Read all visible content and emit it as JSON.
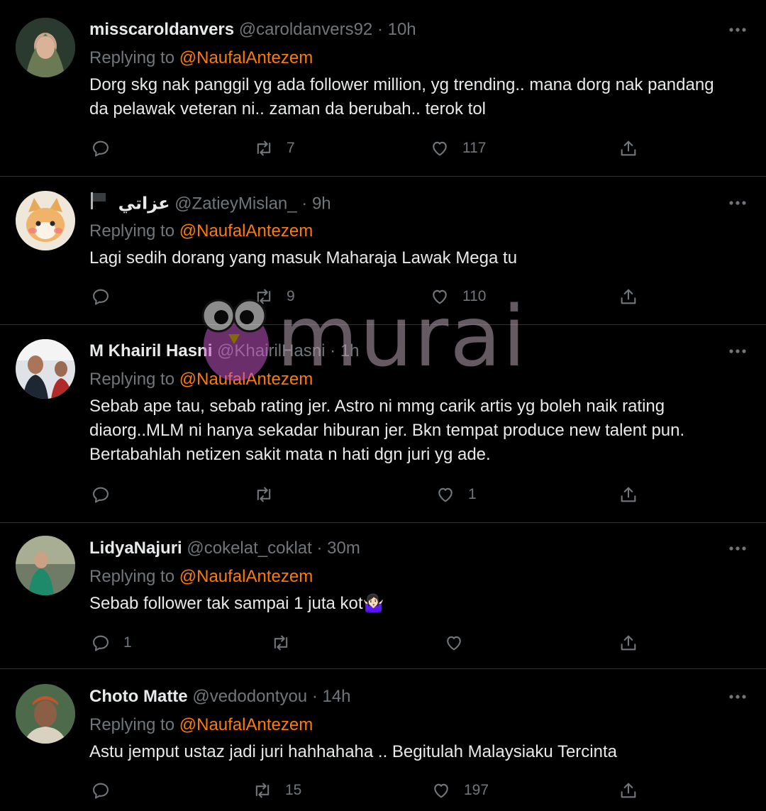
{
  "colors": {
    "background": "#000000",
    "text": "#e7e9ea",
    "muted": "#71767b",
    "mention": "#ff7a00",
    "divider": "#2f3336"
  },
  "icons": {
    "reply": "speech-bubble-icon",
    "retweet": "retweet-arrows-icon",
    "like": "heart-icon",
    "share": "share-upload-icon",
    "more": "more-dots-icon"
  },
  "watermark": {
    "text": "murai"
  },
  "tweets": [
    {
      "name": "misscaroldanvers",
      "handle": "@caroldanvers92",
      "dot": "·",
      "time": "10h",
      "replying_label": "Replying to",
      "mention": "@NaufalAntezem",
      "text_lines": [
        "Dorg skg nak panggil yg ada follower million, yg trending.. mana dorg nak pandang",
        "da pelawak veteran ni.. zaman da berubah.. terok tol"
      ],
      "reply_count": "",
      "retweet_count": "7",
      "like_count": "117"
    },
    {
      "name": "عزاتي",
      "handle": "@ZatieyMislan_",
      "dot": "·",
      "time": "9h",
      "replying_label": "Replying to",
      "mention": "@NaufalAntezem",
      "text_lines": [
        "Lagi sedih dorang yang masuk Maharaja Lawak Mega tu"
      ],
      "reply_count": "",
      "retweet_count": "9",
      "like_count": "110"
    },
    {
      "name": "M Khairil Hasni",
      "handle": "@KhairilHasni",
      "dot": "·",
      "time": "1h",
      "replying_label": "Replying to",
      "mention": "@NaufalAntezem",
      "text_lines": [
        "Sebab ape tau, sebab rating jer. Astro ni mmg carik artis yg boleh naik rating",
        "diaorg..MLM ni hanya sekadar hiburan jer. Bkn tempat produce new talent pun.",
        "Bertabahlah netizen sakit mata n hati dgn juri yg ade."
      ],
      "reply_count": "",
      "retweet_count": "",
      "like_count": "1"
    },
    {
      "name": "LidyaNajuri",
      "handle": "@cokelat_coklat",
      "dot": "·",
      "time": "30m",
      "replying_label": "Replying to",
      "mention": "@NaufalAntezem",
      "text_lines": [
        "Sebab follower tak sampai 1 juta kot🤷🏻‍♀️"
      ],
      "reply_count": "1",
      "retweet_count": "",
      "like_count": ""
    },
    {
      "name": "Choto Matte",
      "handle": "@vedodontyou",
      "dot": "·",
      "time": "14h",
      "replying_label": "Replying to",
      "mention": "@NaufalAntezem",
      "text_lines": [
        "Astu jemput ustaz jadi juri hahhahaha .. Begitulah Malaysiaku Tercinta"
      ],
      "reply_count": "",
      "retweet_count": "15",
      "like_count": "197"
    }
  ]
}
